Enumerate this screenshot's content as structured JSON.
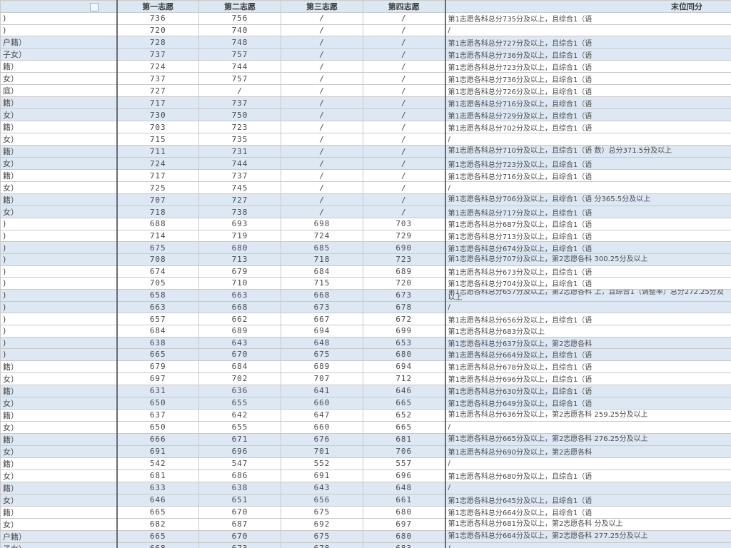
{
  "headers": [
    "",
    "第一志愿",
    "第二志愿",
    "第三志愿",
    "第四志愿",
    "末位同分"
  ],
  "rows": [
    {
      "name": ")",
      "v": [
        "736",
        "756",
        "/",
        "/"
      ],
      "note": "第1志愿各科总分735分及以上，且综合1（语",
      "shade": false
    },
    {
      "name": ")",
      "v": [
        "720",
        "740",
        "/",
        "/"
      ],
      "note": "/",
      "shade": false
    },
    {
      "name": "户籍）",
      "v": [
        "728",
        "748",
        "/",
        "/"
      ],
      "note": "第1志愿各科总分727分及以上，且综合1（语",
      "shade": true
    },
    {
      "name": "子女）",
      "v": [
        "737",
        "757",
        "/",
        "/"
      ],
      "note": "第1志愿各科总分736分及以上，且综合1（语",
      "shade": true
    },
    {
      "name": "籍）",
      "v": [
        "724",
        "744",
        "/",
        "/"
      ],
      "note": "第1志愿各科总分723分及以上，且综合1（语",
      "shade": false
    },
    {
      "name": "女）",
      "v": [
        "737",
        "757",
        "/",
        "/"
      ],
      "note": "第1志愿各科总分736分及以上，且综合1（语",
      "shade": false
    },
    {
      "name": "庭）",
      "v": [
        "727",
        "/",
        "/",
        "/"
      ],
      "note": "第1志愿各科总分726分及以上，且综合1（语",
      "shade": false
    },
    {
      "name": "籍）",
      "v": [
        "717",
        "737",
        "/",
        "/"
      ],
      "note": "第1志愿各科总分716分及以上，且综合1（语",
      "shade": true
    },
    {
      "name": "女）",
      "v": [
        "730",
        "750",
        "/",
        "/"
      ],
      "note": "第1志愿各科总分729分及以上，且综合1（语",
      "shade": true
    },
    {
      "name": "籍）",
      "v": [
        "703",
        "723",
        "/",
        "/"
      ],
      "note": "第1志愿各科总分702分及以上，且综合1（语",
      "shade": false
    },
    {
      "name": "女）",
      "v": [
        "715",
        "735",
        "/",
        "/"
      ],
      "note": "/",
      "shade": false
    },
    {
      "name": "籍）",
      "v": [
        "711",
        "731",
        "/",
        "/"
      ],
      "note": "第1志愿各科总分710分及以上，且综合1（语 数）总分371.5分及以上",
      "shade": true
    },
    {
      "name": "女）",
      "v": [
        "724",
        "744",
        "/",
        "/"
      ],
      "note": "第1志愿各科总分723分及以上，且综合1（语",
      "shade": true
    },
    {
      "name": "籍）",
      "v": [
        "717",
        "737",
        "/",
        "/"
      ],
      "note": "第1志愿各科总分716分及以上，且综合1（语",
      "shade": false
    },
    {
      "name": "女）",
      "v": [
        "725",
        "745",
        "/",
        "/"
      ],
      "note": "/",
      "shade": false
    },
    {
      "name": "籍）",
      "v": [
        "707",
        "727",
        "/",
        "/"
      ],
      "note": "第1志愿各科总分706分及以上，且综合1（语 分365.5分及以上",
      "shade": true
    },
    {
      "name": "女）",
      "v": [
        "718",
        "738",
        "/",
        "/"
      ],
      "note": "第1志愿各科总分717分及以上，且综合1（语",
      "shade": true
    },
    {
      "name": ")",
      "v": [
        "688",
        "693",
        "698",
        "703"
      ],
      "note": "第1志愿各科总分687分及以上，且综合1（语",
      "shade": false
    },
    {
      "name": ")",
      "v": [
        "714",
        "719",
        "724",
        "729"
      ],
      "note": "第1志愿各科总分713分及以上，且综合1（语",
      "shade": false
    },
    {
      "name": ")",
      "v": [
        "675",
        "680",
        "685",
        "690"
      ],
      "note": "第1志愿各科总分674分及以上，且综合1（语",
      "shade": true
    },
    {
      "name": ")",
      "v": [
        "708",
        "713",
        "718",
        "723"
      ],
      "note": "第1志愿各科总分707分及以上，第2志愿各科 300.25分及以上",
      "shade": true
    },
    {
      "name": ")",
      "v": [
        "674",
        "679",
        "684",
        "689"
      ],
      "note": "第1志愿各科总分673分及以上，且综合1（语",
      "shade": false
    },
    {
      "name": ")",
      "v": [
        "705",
        "710",
        "715",
        "720"
      ],
      "note": "第1志愿各科总分704分及以上，且综合1（语",
      "shade": false
    },
    {
      "name": ")",
      "v": [
        "658",
        "663",
        "668",
        "673"
      ],
      "note": "第1志愿各科总分657分及以上，第2志愿各科 上，且综合1（调整率）总分272.25分及以上",
      "shade": true
    },
    {
      "name": ")",
      "v": [
        "663",
        "668",
        "673",
        "678"
      ],
      "note": "/",
      "shade": true
    },
    {
      "name": ")",
      "v": [
        "657",
        "662",
        "667",
        "672"
      ],
      "note": "第1志愿各科总分656分及以上，且综合1（语",
      "shade": false
    },
    {
      "name": ")",
      "v": [
        "684",
        "689",
        "694",
        "699"
      ],
      "note": "第1志愿各科总分683分及以上",
      "shade": false
    },
    {
      "name": ")",
      "v": [
        "638",
        "643",
        "648",
        "653"
      ],
      "note": "第1志愿各科总分637分及以上，第2志愿各科",
      "shade": true
    },
    {
      "name": ")",
      "v": [
        "665",
        "670",
        "675",
        "680"
      ],
      "note": "第1志愿各科总分664分及以上，且综合1（语",
      "shade": true
    },
    {
      "name": "籍）",
      "v": [
        "679",
        "684",
        "689",
        "694"
      ],
      "note": "第1志愿各科总分678分及以上，且综合1（语",
      "shade": false
    },
    {
      "name": "女）",
      "v": [
        "697",
        "702",
        "707",
        "712"
      ],
      "note": "第1志愿各科总分696分及以上，且综合1（语",
      "shade": false
    },
    {
      "name": "籍）",
      "v": [
        "631",
        "636",
        "641",
        "646"
      ],
      "note": "第1志愿各科总分630分及以上，且综合1（语",
      "shade": true
    },
    {
      "name": "女）",
      "v": [
        "650",
        "655",
        "660",
        "665"
      ],
      "note": "第1志愿各科总分649分及以上，且综合1（语",
      "shade": true
    },
    {
      "name": "籍）",
      "v": [
        "637",
        "642",
        "647",
        "652"
      ],
      "note": "第1志愿各科总分636分及以上，第2志愿各科 259.25分及以上",
      "shade": false
    },
    {
      "name": "女）",
      "v": [
        "650",
        "655",
        "660",
        "665"
      ],
      "note": "/",
      "shade": false
    },
    {
      "name": "籍）",
      "v": [
        "666",
        "671",
        "676",
        "681"
      ],
      "note": "第1志愿各科总分665分及以上，第2志愿各科 276.25分及以上",
      "shade": true
    },
    {
      "name": "女）",
      "v": [
        "691",
        "696",
        "701",
        "706"
      ],
      "note": "第1志愿各科总分690分及以上，第2志愿各科",
      "shade": true
    },
    {
      "name": "籍）",
      "v": [
        "542",
        "547",
        "552",
        "557"
      ],
      "note": "/",
      "shade": false
    },
    {
      "name": "女）",
      "v": [
        "681",
        "686",
        "691",
        "696"
      ],
      "note": "第1志愿各科总分680分及以上，且综合1（语",
      "shade": false
    },
    {
      "name": "籍）",
      "v": [
        "633",
        "638",
        "643",
        "648"
      ],
      "note": "/",
      "shade": true
    },
    {
      "name": "女）",
      "v": [
        "646",
        "651",
        "656",
        "661"
      ],
      "note": "第1志愿各科总分645分及以上，且综合1（语",
      "shade": true
    },
    {
      "name": "籍）",
      "v": [
        "665",
        "670",
        "675",
        "680"
      ],
      "note": "第1志愿各科总分664分及以上，且综合1（语",
      "shade": false
    },
    {
      "name": "女）",
      "v": [
        "682",
        "687",
        "692",
        "697"
      ],
      "note": "第1志愿各科总分681分及以上，第2志愿各科 分及以上",
      "shade": false
    },
    {
      "name": "户籍）",
      "v": [
        "665",
        "670",
        "675",
        "680"
      ],
      "note": "第1志愿各科总分664分及以上，第2志愿各科 277.25分及以上",
      "shade": true
    },
    {
      "name": "子女）",
      "v": [
        "668",
        "673",
        "678",
        "683"
      ],
      "note": "/",
      "shade": true
    }
  ]
}
